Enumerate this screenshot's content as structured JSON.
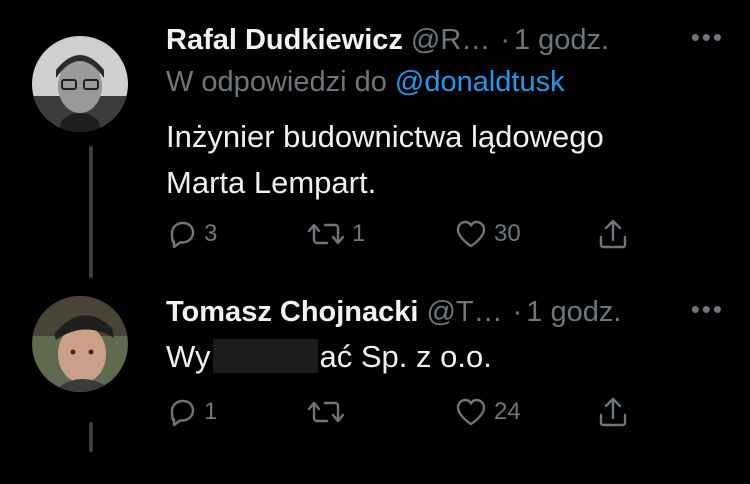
{
  "tweets": [
    {
      "name": "Rafal Dudkiewicz",
      "handle": "@R…",
      "sep": "·",
      "time": "1 godz.",
      "more": "•••",
      "reply_prefix": "W odpowiedzi do",
      "reply_to": "@donaldtusk",
      "text_line1": "Inżynier budownictwa lądowego",
      "text_line2": "Marta Lempart.",
      "replies": "3",
      "retweets": "1",
      "likes": "30"
    },
    {
      "name": "Tomasz Chojnacki",
      "handle": "@T…",
      "sep": "·",
      "time": "1 godz.",
      "more": "•••",
      "text_before": "Wy",
      "text_after": "ać Sp. z o.o.",
      "replies": "1",
      "retweets": "",
      "likes": "24"
    }
  ],
  "colors": {
    "background": "#000000",
    "secondary": "#6e767d",
    "link": "#1d9bf0"
  },
  "icons": [
    "reply-icon",
    "retweet-icon",
    "like-icon",
    "share-icon",
    "more-icon"
  ]
}
